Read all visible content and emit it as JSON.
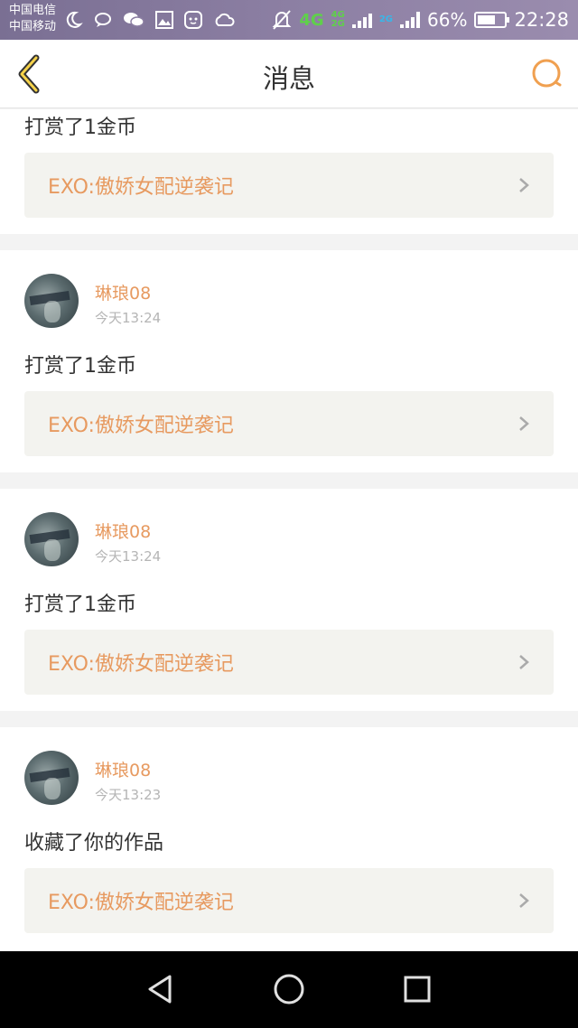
{
  "status_bar": {
    "carrier_1": "中国电信",
    "carrier_2": "中国移动",
    "net_main": "4G",
    "net_small_top": "4G",
    "net_small_bottom": "2G",
    "net_secondary": "2G",
    "battery": "66%",
    "battery_level": 0.66,
    "time": "22:28",
    "icons": [
      "moon-icon",
      "chat-bubble-icon",
      "wechat-icon",
      "image-icon",
      "cat-icon",
      "cloud-icon",
      "mute-icon",
      "signal-icon",
      "battery-icon"
    ]
  },
  "nav": {
    "title": "消息",
    "back_icon": "chevron-left-icon",
    "search_icon": "search-icon",
    "accent_color": "#f0a050"
  },
  "feed": {
    "first_partial": {
      "action": "打赏了1金币",
      "work_title": "EXO:傲娇女配逆袭记"
    },
    "items": [
      {
        "username": "琳琅08",
        "time": "今天13:24",
        "action": "打赏了1金币",
        "work_title": "EXO:傲娇女配逆袭记"
      },
      {
        "username": "琳琅08",
        "time": "今天13:24",
        "action": "打赏了1金币",
        "work_title": "EXO:傲娇女配逆袭记"
      },
      {
        "username": "琳琅08",
        "time": "今天13:23",
        "action": "收藏了你的作品",
        "work_title": "EXO:傲娇女配逆袭记"
      }
    ]
  },
  "system_nav": {
    "back": "triangle-back-icon",
    "home": "circle-home-icon",
    "recents": "square-recents-icon"
  },
  "colors": {
    "username": "#e79a60",
    "work_title": "#e79a60",
    "link_bg": "#f3f3ef",
    "separator": "#f3f3f3"
  }
}
